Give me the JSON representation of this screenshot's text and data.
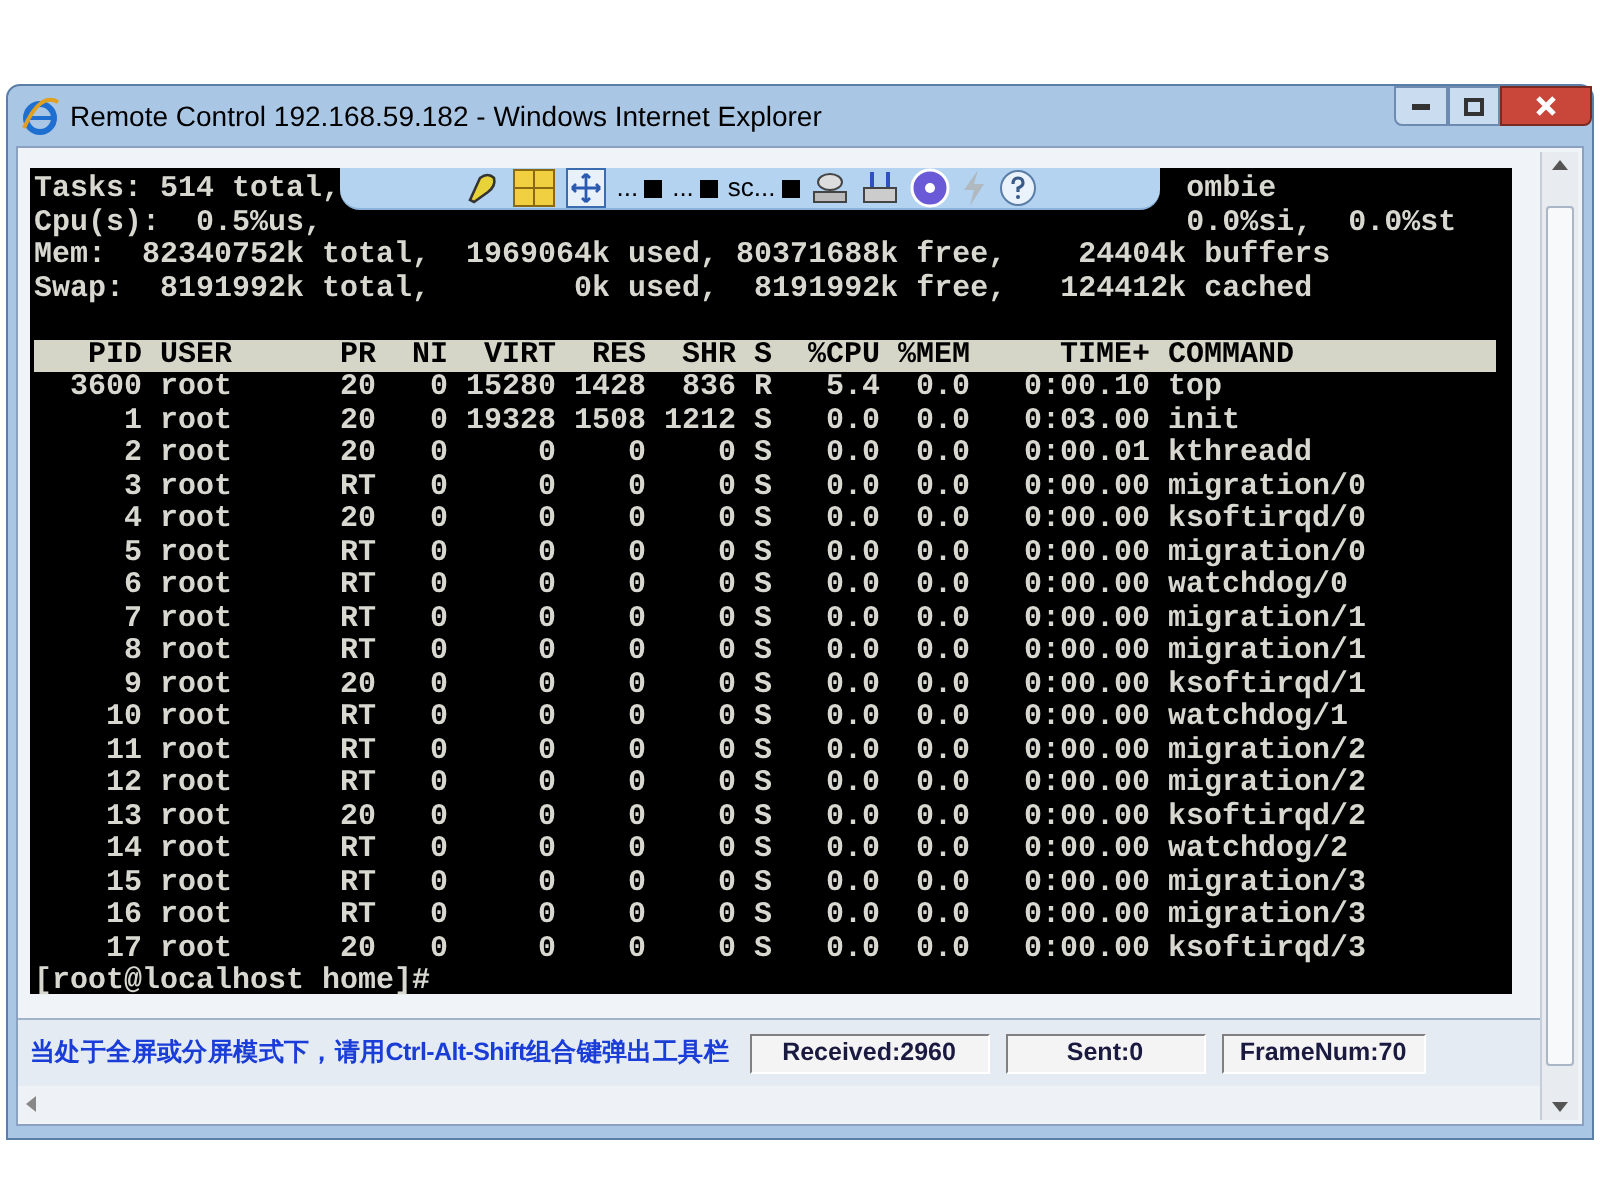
{
  "window": {
    "title": "Remote Control 192.168.59.182 - Windows Internet Explorer"
  },
  "terminal": {
    "summary_lines": [
      [
        "Tasks: 514 total,",
        "ombie"
      ],
      [
        "Cpu(s):  0.5%us,",
        "0.0%si,  0.0%st"
      ],
      [
        "Mem:  82340752k total,  1969064k used, 80371688k free,    24404k buffers"
      ],
      [
        "Swap:  8191992k total,        0k used,  8191992k free,   124412k cached"
      ]
    ],
    "columns": [
      "PID",
      "USER",
      "PR",
      "NI",
      "VIRT",
      "RES",
      "SHR",
      "S",
      "%CPU",
      "%MEM",
      "TIME+",
      "COMMAND"
    ],
    "rows": [
      [
        "3600",
        "root",
        "20",
        "0",
        "15280",
        "1428",
        "836",
        "R",
        "5.4",
        "0.0",
        "0:00.10",
        "top"
      ],
      [
        "1",
        "root",
        "20",
        "0",
        "19328",
        "1508",
        "1212",
        "S",
        "0.0",
        "0.0",
        "0:03.00",
        "init"
      ],
      [
        "2",
        "root",
        "20",
        "0",
        "0",
        "0",
        "0",
        "S",
        "0.0",
        "0.0",
        "0:00.01",
        "kthreadd"
      ],
      [
        "3",
        "root",
        "RT",
        "0",
        "0",
        "0",
        "0",
        "S",
        "0.0",
        "0.0",
        "0:00.00",
        "migration/0"
      ],
      [
        "4",
        "root",
        "20",
        "0",
        "0",
        "0",
        "0",
        "S",
        "0.0",
        "0.0",
        "0:00.00",
        "ksoftirqd/0"
      ],
      [
        "5",
        "root",
        "RT",
        "0",
        "0",
        "0",
        "0",
        "S",
        "0.0",
        "0.0",
        "0:00.00",
        "migration/0"
      ],
      [
        "6",
        "root",
        "RT",
        "0",
        "0",
        "0",
        "0",
        "S",
        "0.0",
        "0.0",
        "0:00.00",
        "watchdog/0"
      ],
      [
        "7",
        "root",
        "RT",
        "0",
        "0",
        "0",
        "0",
        "S",
        "0.0",
        "0.0",
        "0:00.00",
        "migration/1"
      ],
      [
        "8",
        "root",
        "RT",
        "0",
        "0",
        "0",
        "0",
        "S",
        "0.0",
        "0.0",
        "0:00.00",
        "migration/1"
      ],
      [
        "9",
        "root",
        "20",
        "0",
        "0",
        "0",
        "0",
        "S",
        "0.0",
        "0.0",
        "0:00.00",
        "ksoftirqd/1"
      ],
      [
        "10",
        "root",
        "RT",
        "0",
        "0",
        "0",
        "0",
        "S",
        "0.0",
        "0.0",
        "0:00.00",
        "watchdog/1"
      ],
      [
        "11",
        "root",
        "RT",
        "0",
        "0",
        "0",
        "0",
        "S",
        "0.0",
        "0.0",
        "0:00.00",
        "migration/2"
      ],
      [
        "12",
        "root",
        "RT",
        "0",
        "0",
        "0",
        "0",
        "S",
        "0.0",
        "0.0",
        "0:00.00",
        "migration/2"
      ],
      [
        "13",
        "root",
        "20",
        "0",
        "0",
        "0",
        "0",
        "S",
        "0.0",
        "0.0",
        "0:00.00",
        "ksoftirqd/2"
      ],
      [
        "14",
        "root",
        "RT",
        "0",
        "0",
        "0",
        "0",
        "S",
        "0.0",
        "0.0",
        "0:00.00",
        "watchdog/2"
      ],
      [
        "15",
        "root",
        "RT",
        "0",
        "0",
        "0",
        "0",
        "S",
        "0.0",
        "0.0",
        "0:00.00",
        "migration/3"
      ],
      [
        "16",
        "root",
        "RT",
        "0",
        "0",
        "0",
        "0",
        "S",
        "0.0",
        "0.0",
        "0:00.00",
        "migration/3"
      ],
      [
        "17",
        "root",
        "20",
        "0",
        "0",
        "0",
        "0",
        "S",
        "0.0",
        "0.0",
        "0:00.00",
        "ksoftirqd/3"
      ]
    ],
    "prompt": "[root@localhost home]#"
  },
  "overlay_toolbar": {
    "items": [
      {
        "kind": "pen"
      },
      {
        "kind": "grid"
      },
      {
        "kind": "move"
      },
      {
        "kind": "menu",
        "label": "..."
      },
      {
        "kind": "menu",
        "label": "..."
      },
      {
        "kind": "menu",
        "label": "sc..."
      },
      {
        "kind": "disk"
      },
      {
        "kind": "scanner"
      },
      {
        "kind": "disc"
      },
      {
        "kind": "bolt"
      },
      {
        "kind": "help"
      }
    ]
  },
  "status_bar": {
    "message": "当处于全屏或分屏模式下，请用Ctrl-Alt-Shift组合键弹出工具栏",
    "fields": [
      "Received:2960",
      "Sent:0",
      "FrameNum:70"
    ]
  }
}
